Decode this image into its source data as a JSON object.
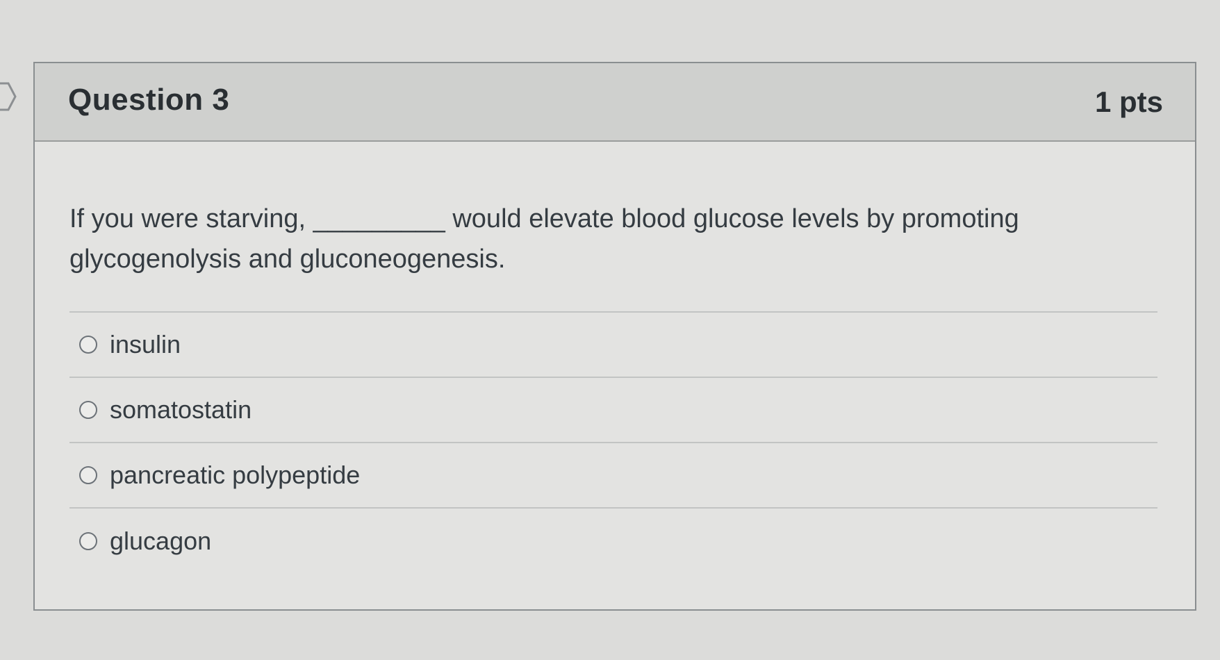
{
  "question": {
    "title": "Question 3",
    "points": "1 pts",
    "text_line1": "If you were starving, _________ would elevate blood glucose levels by promoting",
    "text_line2": "glycogenolysis and gluconeogenesis.",
    "answers": [
      {
        "label": "insulin"
      },
      {
        "label": "somatostatin"
      },
      {
        "label": "pancreatic polypeptide"
      },
      {
        "label": "glucagon"
      }
    ]
  },
  "icons": {
    "flag": "chevron-right-icon",
    "answer_control": "radio-icon"
  }
}
